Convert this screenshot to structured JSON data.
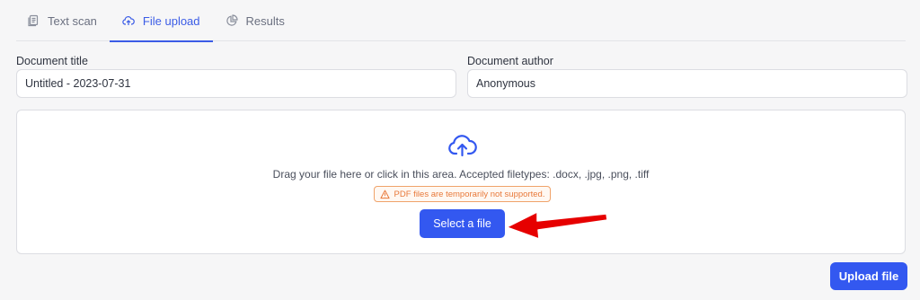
{
  "tabs": [
    {
      "label": "Text scan",
      "icon": "document-stack-icon",
      "active": false
    },
    {
      "label": "File upload",
      "icon": "cloud-upload-icon",
      "active": true
    },
    {
      "label": "Results",
      "icon": "pie-chart-icon",
      "active": false
    }
  ],
  "form": {
    "title_label": "Document title",
    "title_value": "Untitled - 2023-07-31",
    "author_label": "Document author",
    "author_value": "Anonymous"
  },
  "dropzone": {
    "instructions": "Drag your file here or click in this area. Accepted filetypes: .docx, .jpg, .png, .tiff",
    "warning": "PDF files are temporarily not supported.",
    "select_label": "Select a file"
  },
  "actions": {
    "upload_label": "Upload file"
  },
  "colors": {
    "accent": "#3358f0",
    "warning": "#e8793a",
    "annotation_arrow": "#e60000"
  }
}
